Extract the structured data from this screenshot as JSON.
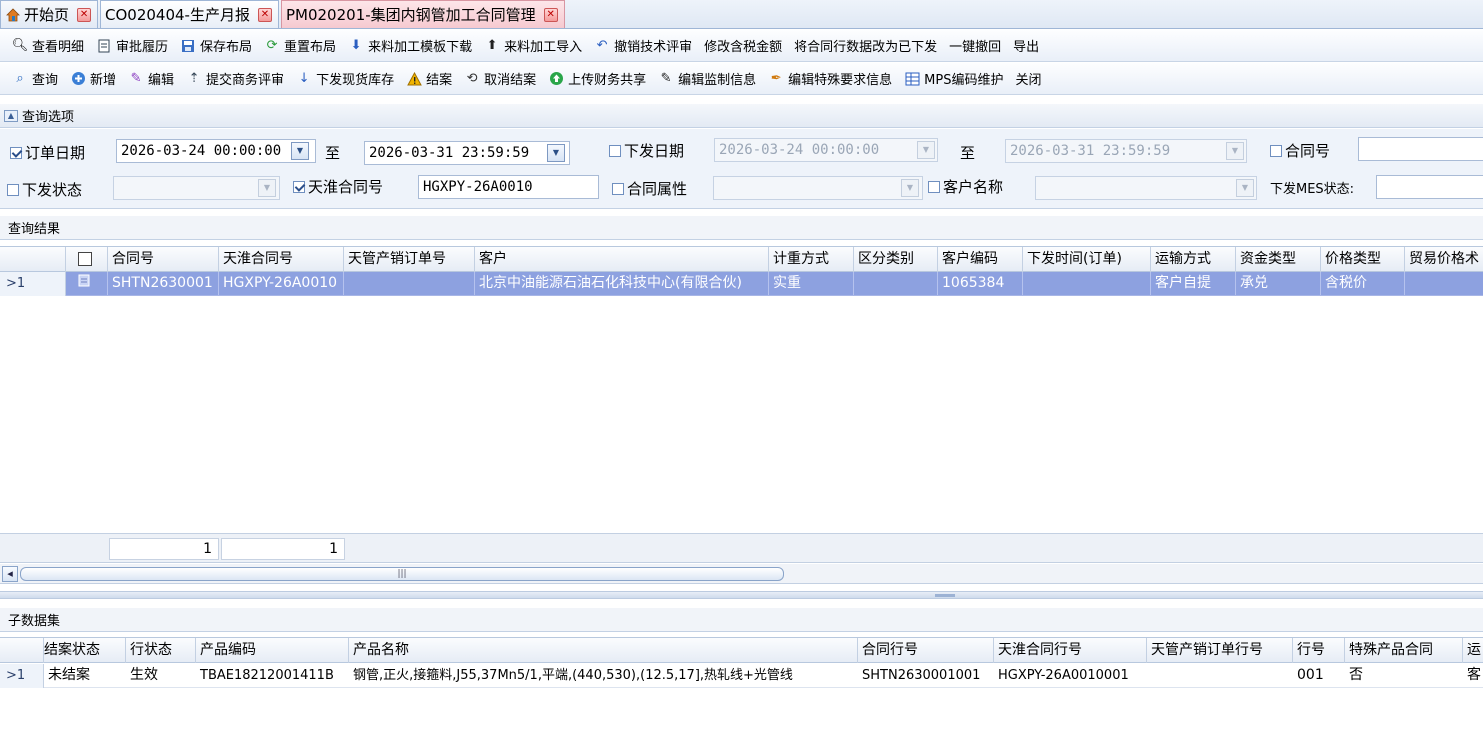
{
  "tabs": [
    {
      "label": "开始页",
      "kind": "home"
    },
    {
      "label": "CO020404-生产月报",
      "kind": "normal"
    },
    {
      "label": "PM020201-集团内钢管加工合同管理",
      "kind": "active"
    }
  ],
  "toolbar1": [
    {
      "label": "查看明细",
      "icon": "magnifier-icon"
    },
    {
      "label": "审批履历",
      "icon": "document-icon"
    },
    {
      "label": "保存布局",
      "icon": "save-icon"
    },
    {
      "label": "重置布局",
      "icon": "reset-icon"
    },
    {
      "label": "来料加工模板下载",
      "icon": "arrow-down-icon"
    },
    {
      "label": "来料加工导入",
      "icon": "arrow-up-icon"
    },
    {
      "label": "撤销技术评审",
      "icon": "undo-icon"
    },
    {
      "label": "修改含税金额",
      "icon": ""
    },
    {
      "label": "将合同行数据改为已下发",
      "icon": ""
    },
    {
      "label": "一键撤回",
      "icon": ""
    },
    {
      "label": "导出",
      "icon": ""
    }
  ],
  "toolbar2": [
    {
      "label": "查询",
      "icon": "search-user-icon"
    },
    {
      "label": "新增",
      "icon": "plus-circle-icon"
    },
    {
      "label": "编辑",
      "icon": "pencil-icon"
    },
    {
      "label": "提交商务评审",
      "icon": "sort-up-icon"
    },
    {
      "label": "下发现货库存",
      "icon": "arrow-down-icon"
    },
    {
      "label": "结案",
      "icon": "warning-icon"
    },
    {
      "label": "取消结案",
      "icon": "clock-back-icon"
    },
    {
      "label": "上传财务共享",
      "icon": "upload-circle-icon"
    },
    {
      "label": "编辑监制信息",
      "icon": "edit-box-icon"
    },
    {
      "label": "编辑特殊要求信息",
      "icon": "paint-icon"
    },
    {
      "label": "MPS编码维护",
      "icon": "grid-icon"
    },
    {
      "label": "关闭",
      "icon": ""
    }
  ],
  "query": {
    "title": "查询选项",
    "order_date_label": "订单日期",
    "order_date_from": "2026-03-24 00:00:00",
    "to_label": "至",
    "order_date_to": "2026-03-31 23:59:59",
    "issue_date_label": "下发日期",
    "issue_date_from": "2026-03-24 00:00:00",
    "issue_date_to": "2026-03-31 23:59:59",
    "contract_no_label": "合同号",
    "issue_status_label": "下发状态",
    "tianzhun_contract_label": "天淮合同号",
    "tianzhun_contract_value": "HGXPY-26A0010",
    "contract_attr_label": "合同属性",
    "customer_name_label": "客户名称",
    "mes_status_label": "下发MES状态:"
  },
  "results": {
    "title": "查询结果",
    "columns": [
      "合同号",
      "天淮合同号",
      "天管产销订单号",
      "客户",
      "计重方式",
      "区分类别",
      "客户编码",
      "下发时间(订单)",
      "运输方式",
      "资金类型",
      "价格类型",
      "贸易价格术"
    ],
    "row": {
      "index": "1",
      "cells": [
        "SHTN2630001",
        "HGXPY-26A0010",
        "",
        "北京中油能源石油石化科技中心(有限合伙)",
        "实重",
        "",
        "1065384",
        "",
        "客户自提",
        "承兑",
        "含税价",
        ""
      ]
    },
    "footer": [
      "1",
      "1"
    ]
  },
  "children": {
    "title": "子数据集",
    "columns": [
      "结案状态",
      "行状态",
      "产品编码",
      "产品名称",
      "合同行号",
      "天淮合同行号",
      "天管产销订单行号",
      "行号",
      "特殊产品合同",
      "运"
    ],
    "row": {
      "index": "1",
      "cells": [
        "未结案",
        "生效",
        "TBAE18212001411B",
        "钢管,正火,接箍料,J55,37Mn5/1,平端,(440,530),(12.5,17],热轧线+光管线",
        "SHTN2630001001",
        "HGXPY-26A0010001",
        "",
        "001",
        "否",
        "客"
      ]
    }
  },
  "colors": {
    "selected_row": "#8da1e0",
    "active_tab": "#f6c9d0"
  }
}
